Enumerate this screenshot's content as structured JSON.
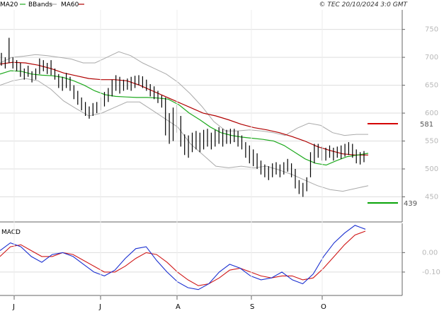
{
  "header": {
    "legend": [
      {
        "label": "MA20",
        "color": "#1faa1f"
      },
      {
        "label": "BBands",
        "color": "#aaaaaa"
      },
      {
        "label": "MA60",
        "color": "#b00000"
      }
    ],
    "copyright": "© TEC 20/10/2024 3:0 GMT"
  },
  "chart_data": [
    {
      "type": "ohlc",
      "title": "",
      "ylim": [
        405,
        785
      ],
      "y_ticks": [
        450,
        500,
        550,
        600,
        650,
        700,
        750
      ],
      "x_month_labels": [
        "J",
        "J",
        "A",
        "S",
        "O"
      ],
      "grid": true,
      "levels": [
        {
          "label": "581",
          "value": 581,
          "color": "#d40000"
        },
        {
          "label": "439",
          "value": 439,
          "color": "#00a000"
        }
      ],
      "series": [
        {
          "name": "MA20",
          "color": "#1faa1f",
          "values": [
            670,
            676,
            675,
            670,
            668,
            667,
            664,
            658,
            650,
            640,
            633,
            630,
            629,
            628,
            628,
            627,
            625,
            615,
            600,
            588,
            575,
            565,
            560,
            557,
            555,
            553,
            550,
            542,
            530,
            518,
            510,
            507,
            515,
            522,
            525,
            528
          ]
        },
        {
          "name": "MA60",
          "color": "#b00000",
          "values": [
            688,
            691,
            690,
            686,
            680,
            672,
            667,
            662,
            660,
            660,
            658,
            650,
            640,
            630,
            620,
            610,
            600,
            595,
            588,
            580,
            574,
            570,
            565,
            558,
            550,
            540,
            533,
            527,
            525,
            525
          ]
        },
        {
          "name": "BBands upper",
          "color": "#aaaaaa",
          "values": [
            690,
            700,
            702,
            705,
            703,
            700,
            697,
            690,
            690,
            700,
            710,
            703,
            690,
            680,
            670,
            655,
            635,
            612,
            585,
            568,
            568,
            570,
            568,
            565,
            560,
            573,
            582,
            578,
            565,
            560,
            562,
            562
          ]
        },
        {
          "name": "BBands lower",
          "color": "#aaaaaa",
          "values": [
            650,
            658,
            662,
            658,
            643,
            622,
            608,
            595,
            600,
            610,
            620,
            620,
            605,
            590,
            575,
            545,
            525,
            505,
            502,
            505,
            502,
            505,
            498,
            490,
            480,
            470,
            463,
            460,
            465,
            470
          ]
        }
      ],
      "bars": [
        {
          "y": [
            685,
            708
          ]
        },
        {
          "y": [
            680,
            700
          ]
        },
        {
          "y": [
            690,
            735
          ]
        },
        {
          "y": [
            680,
            700
          ]
        },
        {
          "y": [
            675,
            695
          ]
        },
        {
          "y": [
            665,
            690
          ]
        },
        {
          "y": [
            660,
            680
          ]
        },
        {
          "y": [
            665,
            685
          ]
        },
        {
          "y": [
            655,
            675
          ]
        },
        {
          "y": [
            660,
            680
          ]
        },
        {
          "y": [
            670,
            698
          ]
        },
        {
          "y": [
            675,
            695
          ]
        },
        {
          "y": [
            670,
            690
          ]
        },
        {
          "y": [
            668,
            695
          ]
        },
        {
          "y": [
            660,
            680
          ]
        },
        {
          "y": [
            645,
            670
          ]
        },
        {
          "y": [
            640,
            665
          ]
        },
        {
          "y": [
            645,
            672
          ]
        },
        {
          "y": [
            640,
            665
          ]
        },
        {
          "y": [
            625,
            650
          ]
        },
        {
          "y": [
            615,
            640
          ]
        },
        {
          "y": [
            605,
            628
          ]
        },
        {
          "y": [
            595,
            620
          ]
        },
        {
          "y": [
            590,
            612
          ]
        },
        {
          "y": [
            595,
            618
          ]
        },
        {
          "y": [
            600,
            620
          ]
        },
        {
          "y": [
            605,
            628
          ]
        },
        {
          "y": [
            612,
            638
          ]
        },
        {
          "y": [
            620,
            645
          ]
        },
        {
          "y": [
            630,
            660
          ]
        },
        {
          "y": [
            640,
            668
          ]
        },
        {
          "y": [
            635,
            665
          ]
        },
        {
          "y": [
            640,
            660
          ]
        },
        {
          "y": [
            642,
            662
          ]
        },
        {
          "y": [
            640,
            665
          ]
        },
        {
          "y": [
            645,
            667
          ]
        },
        {
          "y": [
            650,
            668
          ]
        },
        {
          "y": [
            645,
            666
          ]
        },
        {
          "y": [
            640,
            660
          ]
        },
        {
          "y": [
            630,
            652
          ]
        },
        {
          "y": [
            625,
            648
          ]
        },
        {
          "y": [
            618,
            640
          ]
        },
        {
          "y": [
            610,
            632
          ]
        },
        {
          "y": [
            560,
            628
          ]
        },
        {
          "y": [
            545,
            600
          ]
        },
        {
          "y": [
            550,
            610
          ]
        },
        {
          "y": [
            565,
            615
          ]
        },
        {
          "y": [
            540,
            595
          ]
        },
        {
          "y": [
            525,
            562
          ]
        },
        {
          "y": [
            520,
            560
          ]
        },
        {
          "y": [
            530,
            565
          ]
        },
        {
          "y": [
            535,
            568
          ]
        },
        {
          "y": [
            530,
            565
          ]
        },
        {
          "y": [
            535,
            570
          ]
        },
        {
          "y": [
            540,
            572
          ]
        },
        {
          "y": [
            535,
            565
          ]
        },
        {
          "y": [
            540,
            570
          ]
        },
        {
          "y": [
            545,
            575
          ]
        },
        {
          "y": [
            540,
            572
          ]
        },
        {
          "y": [
            545,
            570
          ]
        },
        {
          "y": [
            545,
            572
          ]
        },
        {
          "y": [
            548,
            572
          ]
        },
        {
          "y": [
            540,
            568
          ]
        },
        {
          "y": [
            535,
            560
          ]
        },
        {
          "y": [
            520,
            548
          ]
        },
        {
          "y": [
            510,
            542
          ]
        },
        {
          "y": [
            505,
            535
          ]
        },
        {
          "y": [
            500,
            528
          ]
        },
        {
          "y": [
            490,
            515
          ]
        },
        {
          "y": [
            485,
            508
          ]
        },
        {
          "y": [
            480,
            505
          ]
        },
        {
          "y": [
            485,
            510
          ]
        },
        {
          "y": [
            490,
            512
          ]
        },
        {
          "y": [
            485,
            508
          ]
        },
        {
          "y": [
            490,
            512
          ]
        },
        {
          "y": [
            495,
            518
          ]
        },
        {
          "y": [
            485,
            510
          ]
        },
        {
          "y": [
            465,
            500
          ]
        },
        {
          "y": [
            455,
            480
          ]
        },
        {
          "y": [
            450,
            475
          ]
        },
        {
          "y": [
            460,
            485
          ]
        },
        {
          "y": [
            485,
            530
          ]
        },
        {
          "y": [
            510,
            545
          ]
        },
        {
          "y": [
            520,
            545
          ]
        },
        {
          "y": [
            515,
            540
          ]
        },
        {
          "y": [
            515,
            538
          ]
        },
        {
          "y": [
            520,
            542
          ]
        },
        {
          "y": [
            515,
            538
          ]
        },
        {
          "y": [
            520,
            540
          ]
        },
        {
          "y": [
            518,
            542
          ]
        },
        {
          "y": [
            522,
            545
          ]
        },
        {
          "y": [
            525,
            548
          ]
        },
        {
          "y": [
            520,
            545
          ]
        },
        {
          "y": [
            510,
            535
          ]
        },
        {
          "y": [
            508,
            530
          ]
        },
        {
          "y": [
            512,
            532
          ]
        }
      ]
    },
    {
      "type": "line",
      "title": "MACD",
      "ylim": [
        -22,
        15
      ],
      "y_ticks": [
        0,
        -10
      ],
      "y_tick_labels": [
        "0.00",
        "-0.10"
      ],
      "grid": true,
      "series": [
        {
          "name": "MACD",
          "color": "#1a2fd0",
          "values": [
            1,
            5,
            3,
            -2,
            -5,
            -1,
            0,
            -2,
            -6,
            -10,
            -12,
            -9,
            -3,
            2,
            3,
            -4,
            -10,
            -15,
            -18,
            -19,
            -16,
            -10,
            -6,
            -8,
            -12,
            -14,
            -13,
            -10,
            -14,
            -16,
            -11,
            -2,
            5,
            10,
            14,
            12
          ]
        },
        {
          "name": "Signal",
          "color": "#d01818",
          "values": [
            -2,
            3,
            4,
            1,
            -2,
            -2,
            0,
            -1,
            -4,
            -7,
            -10,
            -10,
            -7,
            -3,
            0,
            -1,
            -5,
            -10,
            -14,
            -17,
            -16,
            -13,
            -9,
            -8,
            -10,
            -12,
            -13,
            -12,
            -12,
            -14,
            -13,
            -8,
            -2,
            4,
            9,
            11
          ]
        }
      ]
    }
  ]
}
